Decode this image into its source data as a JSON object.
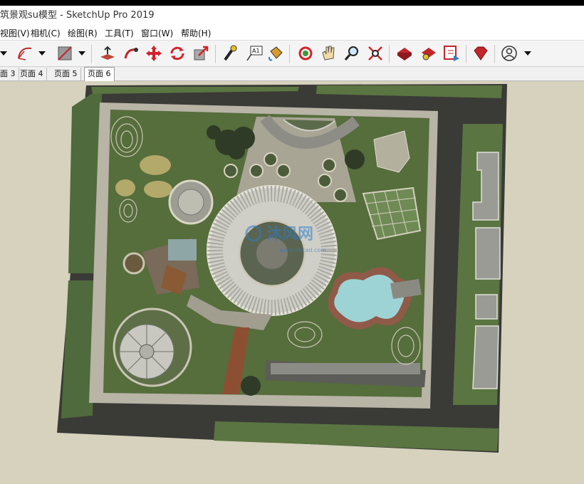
{
  "window": {
    "title": "筑景观su模型 - SketchUp Pro 2019"
  },
  "menu": {
    "items": [
      "视图(V)",
      "相机(C)",
      "绘图(R)",
      "工具(T)",
      "窗口(W)",
      "帮助(H)"
    ]
  },
  "toolbar": {
    "icons": [
      "dropdown-arrow",
      "arc-tool",
      "dropdown-arrow",
      "rectangle-tool",
      "dropdown-arrow",
      "push-pull-tool",
      "follow-me-tool",
      "move-tool",
      "rotate-tool",
      "scale-tool",
      "tape-measure-tool",
      "text-tool",
      "paint-bucket-tool",
      "orbit-tool",
      "pan-tool",
      "zoom-tool",
      "zoom-extents-tool",
      "3d-warehouse",
      "extension-warehouse",
      "layout-send",
      "extension-manager",
      "account-icon",
      "dropdown-arrow"
    ],
    "text_label": "A1"
  },
  "tabs": {
    "items": [
      "面 3",
      "页面 4",
      "页面 5",
      "页面 6"
    ],
    "active": "页面 6"
  },
  "viewport": {
    "background_color": "#d6d2bd",
    "watermark": "沐风网",
    "watermark_url": "www.mfcad.com"
  }
}
